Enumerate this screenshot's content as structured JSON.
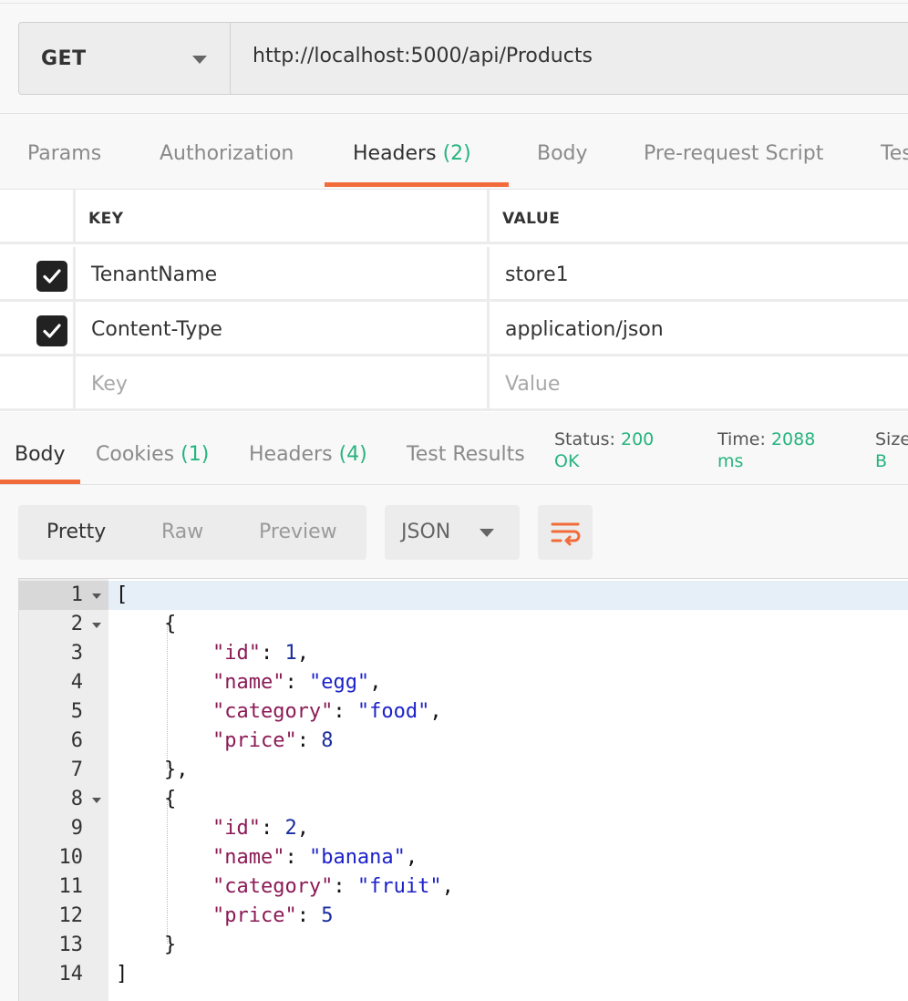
{
  "request": {
    "method": "GET",
    "url": "http://localhost:5000/api/Products"
  },
  "request_tabs": {
    "params": "Params",
    "authorization": "Authorization",
    "headers": "Headers",
    "headers_count": "(2)",
    "body": "Body",
    "prerequest": "Pre-request Script",
    "tests": "Tes"
  },
  "headers_table": {
    "key_header": "KEY",
    "value_header": "VALUE",
    "rows": [
      {
        "key": "TenantName",
        "value": "store1",
        "checked": true
      },
      {
        "key": "Content-Type",
        "value": "application/json",
        "checked": true
      }
    ],
    "key_placeholder": "Key",
    "value_placeholder": "Value"
  },
  "response_tabs": {
    "body": "Body",
    "cookies": "Cookies",
    "cookies_count": "(1)",
    "headers": "Headers",
    "headers_count": "(4)",
    "test_results": "Test Results"
  },
  "status": {
    "status_label": "Status:",
    "status_value_1": "200",
    "status_value_2": "OK",
    "time_label": "Time:",
    "time_value_1": "2088",
    "time_value_2": "ms",
    "size_label": "Size",
    "size_value": "B"
  },
  "response_view": {
    "pretty": "Pretty",
    "raw": "Raw",
    "preview": "Preview",
    "format": "JSON",
    "wrap_icon": "wrap-lines-icon"
  },
  "code": {
    "line_numbers": [
      "1",
      "2",
      "3",
      "4",
      "5",
      "6",
      "7",
      "8",
      "9",
      "10",
      "11",
      "12",
      "13",
      "14"
    ],
    "items": [
      {
        "id_key": "\"id\"",
        "id": "1",
        "name_key": "\"name\"",
        "name": "\"egg\"",
        "category_key": "\"category\"",
        "category": "\"food\"",
        "price_key": "\"price\"",
        "price": "8"
      },
      {
        "id_key": "\"id\"",
        "id": "2",
        "name_key": "\"name\"",
        "name": "\"banana\"",
        "category_key": "\"category\"",
        "category": "\"fruit\"",
        "price_key": "\"price\"",
        "price": "5"
      }
    ]
  },
  "colors": {
    "accent": "#f26b3a",
    "count_green": "#26b47f",
    "json_key": "#8b1a55",
    "json_string": "#1c22c8",
    "json_number": "#1a2d9c"
  }
}
